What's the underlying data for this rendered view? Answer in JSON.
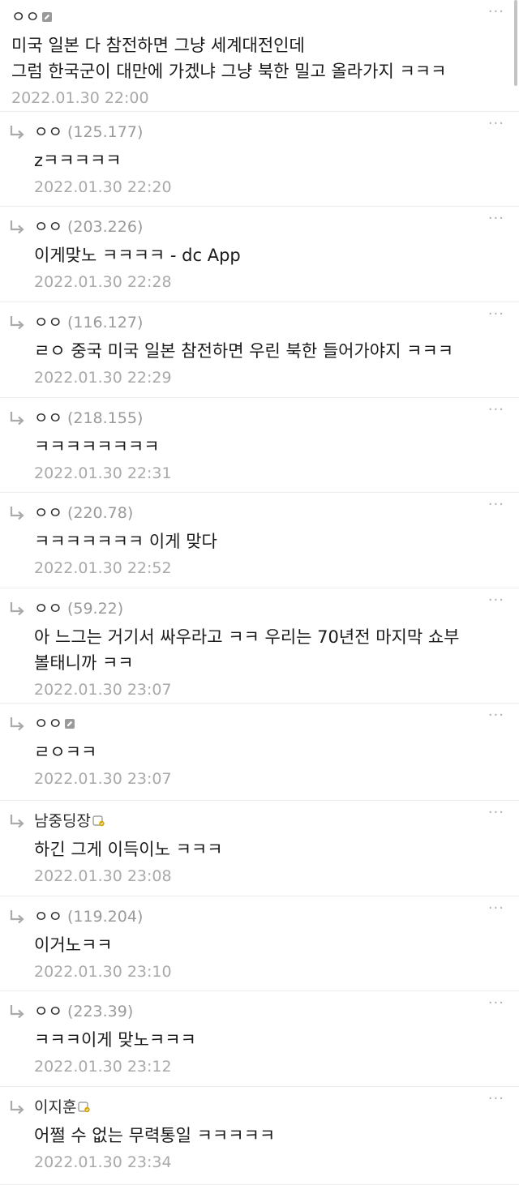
{
  "comments": [
    {
      "type": "top",
      "author": "ㅇㅇ",
      "ip": "",
      "badge": "edit-badge-icon",
      "text": "미국 일본 다 참전하면 그냥 세계대전인데\n그럼 한국군이 대만에 가겠냐 그냥 북한 밀고 올라가지 ㅋㅋㅋ",
      "date": "2022.01.30 22:00"
    },
    {
      "type": "reply",
      "author": "ㅇㅇ",
      "ip": "(125.177)",
      "badge": "",
      "text": "zㅋㅋㅋㅋㅋ",
      "date": "2022.01.30 22:20"
    },
    {
      "type": "reply",
      "author": "ㅇㅇ",
      "ip": "(203.226)",
      "badge": "",
      "text": "이게맞노 ㅋㅋㅋㅋ - dc App",
      "date": "2022.01.30 22:28"
    },
    {
      "type": "reply",
      "author": "ㅇㅇ",
      "ip": "(116.127)",
      "badge": "",
      "text": "ㄹㅇ 중국 미국 일본 참전하면 우린 북한 들어가야지 ㅋㅋㅋ",
      "date": "2022.01.30 22:29"
    },
    {
      "type": "reply",
      "author": "ㅇㅇ",
      "ip": "(218.155)",
      "badge": "",
      "text": "ㅋㅋㅋㅋㅋㅋㅋㅋ",
      "date": "2022.01.30 22:31"
    },
    {
      "type": "reply",
      "author": "ㅇㅇ",
      "ip": "(220.78)",
      "badge": "",
      "text": "ㅋㅋㅋㅋㅋㅋㅋ 이게 맞다",
      "date": "2022.01.30 22:52"
    },
    {
      "type": "reply",
      "author": "ㅇㅇ",
      "ip": "(59.22)",
      "badge": "",
      "text": "아 느그는 거기서 싸우라고 ㅋㅋ 우리는 70년전 마지막 쇼부 볼태니까 ㅋㅋ",
      "date": "2022.01.30 23:07"
    },
    {
      "type": "reply",
      "author": "ㅇㅇ",
      "ip": "",
      "badge": "edit-badge-icon",
      "text": "ㄹㅇㅋㅋ",
      "date": "2022.01.30 23:07"
    },
    {
      "type": "reply",
      "author": "남중딩장",
      "ip": "",
      "badge": "fixed-nick-badge-icon",
      "text": "하긴 그게 이득이노 ㅋㅋㅋ",
      "date": "2022.01.30 23:08"
    },
    {
      "type": "reply",
      "author": "ㅇㅇ",
      "ip": "(119.204)",
      "badge": "",
      "text": "이거노ㅋㅋ",
      "date": "2022.01.30 23:10"
    },
    {
      "type": "reply",
      "author": "ㅇㅇ",
      "ip": "(223.39)",
      "badge": "",
      "text": "ㅋㅋㅋ이게 맞노ㅋㅋㅋ",
      "date": "2022.01.30 23:12"
    },
    {
      "type": "reply",
      "author": "이지훈",
      "ip": "",
      "badge": "fixed-nick-badge-icon",
      "text": "어쩔 수 없는 무력통일 ㅋㅋㅋㅋㅋ",
      "date": "2022.01.30 23:34"
    }
  ],
  "more_icon": "more-dots-icon",
  "reply_icon": "reply-arrow-icon",
  "colors": {
    "text": "#1a1a1a",
    "meta": "#a9a9a9",
    "divider": "#ececec",
    "badge_gray": "#8e8e8e",
    "badge_gold": "#d9a400"
  }
}
